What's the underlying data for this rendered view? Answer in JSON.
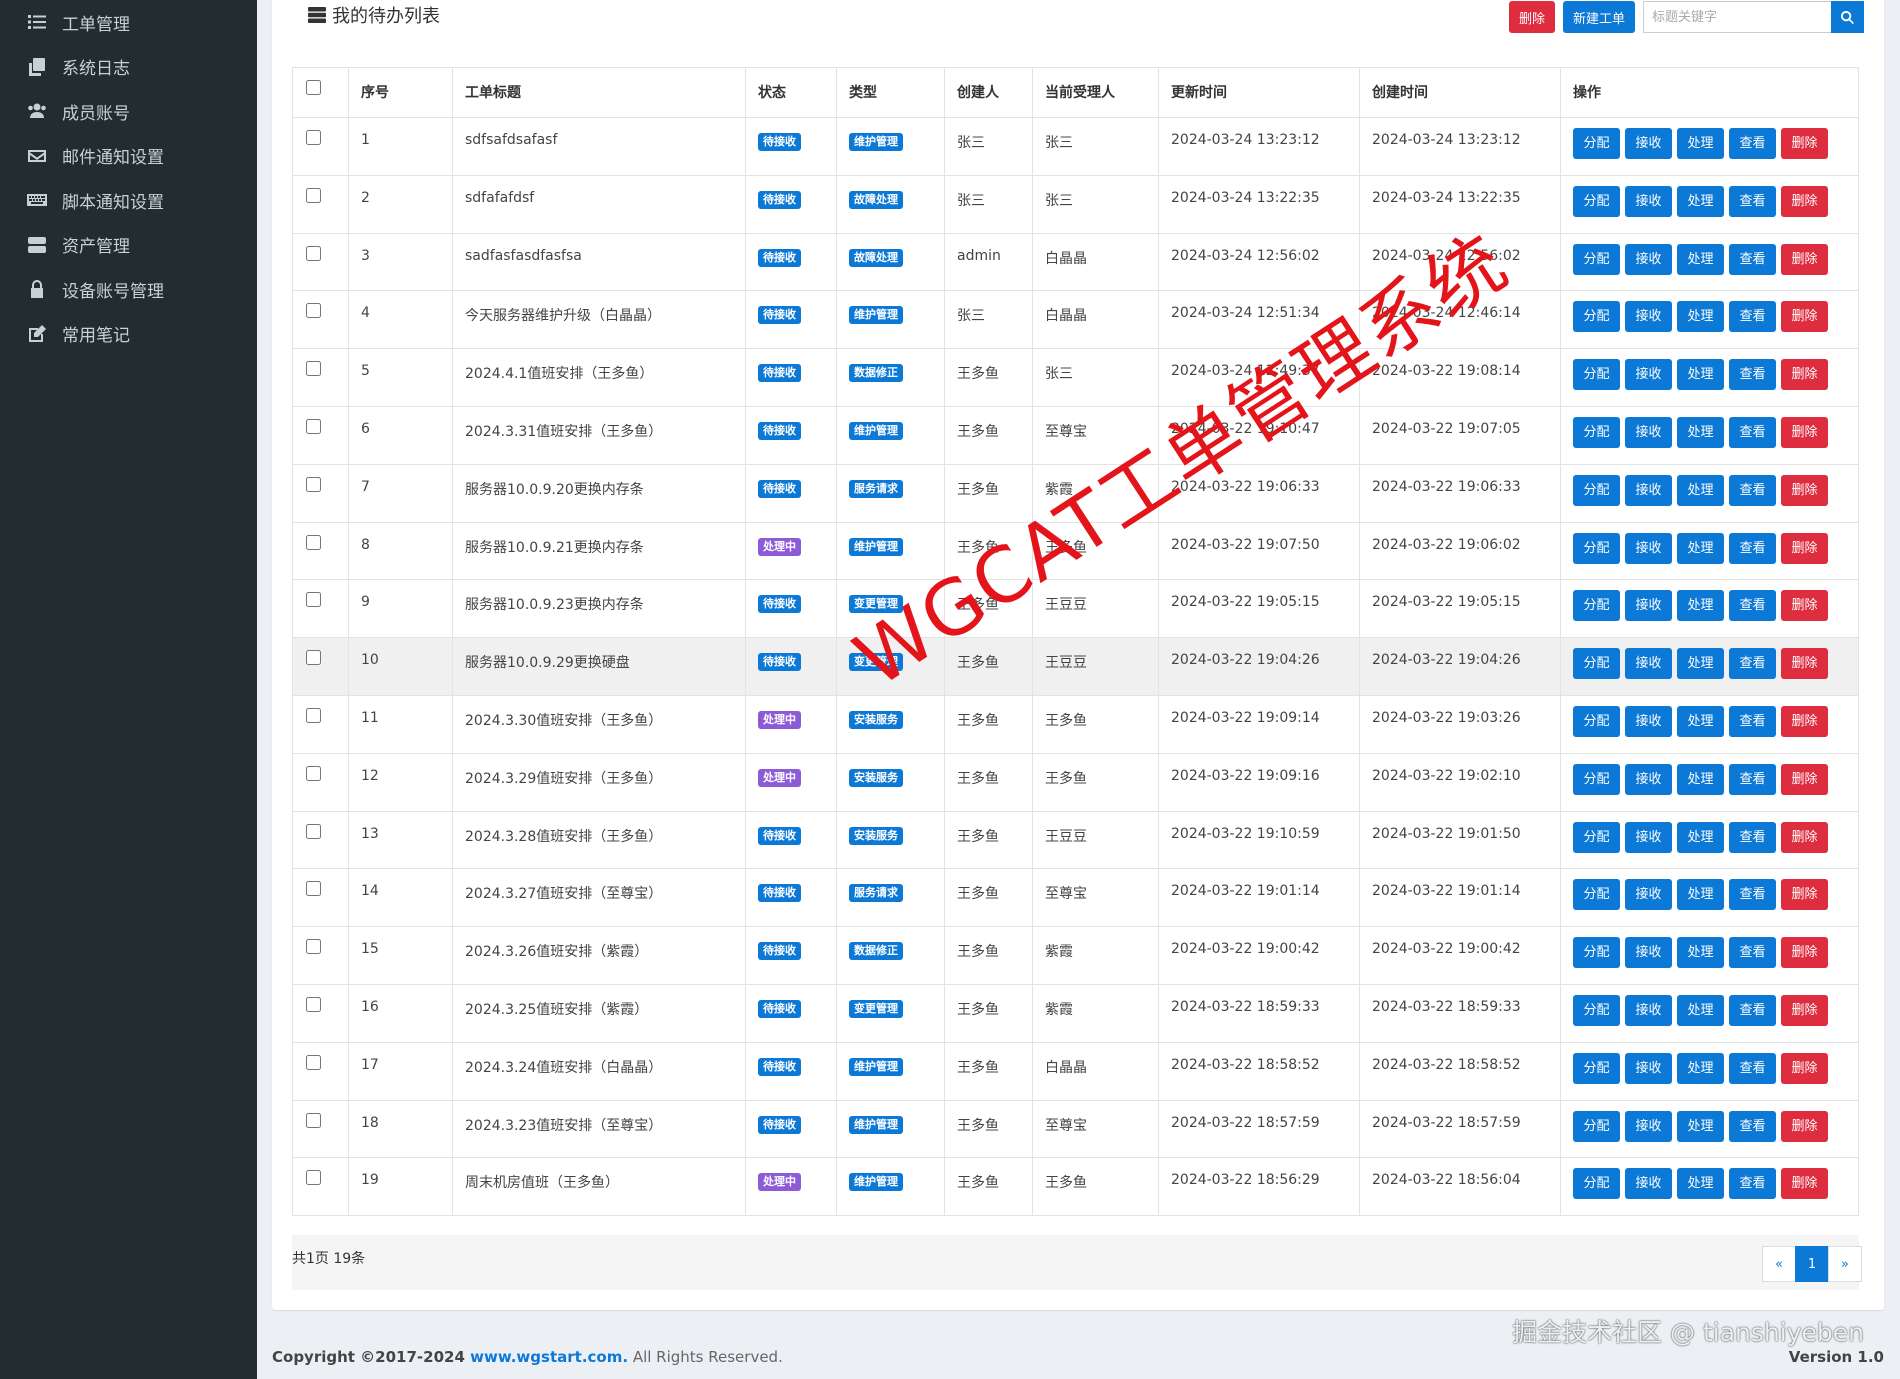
{
  "sidebar": {
    "items": [
      {
        "label": "工单管理",
        "icon": "list-icon"
      },
      {
        "label": "系统日志",
        "icon": "copy-icon"
      },
      {
        "label": "成员账号",
        "icon": "users-icon"
      },
      {
        "label": "邮件通知设置",
        "icon": "envelope-icon"
      },
      {
        "label": "脚本通知设置",
        "icon": "keyboard-icon"
      },
      {
        "label": "资产管理",
        "icon": "server-icon"
      },
      {
        "label": "设备账号管理",
        "icon": "lock-icon"
      },
      {
        "label": "常用笔记",
        "icon": "edit-icon"
      }
    ]
  },
  "box": {
    "title": "我的待办列表",
    "delete_label": "删除",
    "new_label": "新建工单",
    "search_placeholder": "标题关键字"
  },
  "table": {
    "headers": {
      "index": "序号",
      "title": "工单标题",
      "status": "状态",
      "type": "类型",
      "creator": "创建人",
      "assignee": "当前受理人",
      "updated": "更新时间",
      "created": "创建时间",
      "actions": "操作"
    },
    "action_labels": [
      "分配",
      "接收",
      "处理",
      "查看",
      "删除"
    ],
    "rows": [
      {
        "index": "1",
        "title": "sdfsafdsafasf",
        "status": "待接收",
        "type": "维护管理",
        "creator": "张三",
        "assignee": "张三",
        "updated": "2024-03-24 13:23:12",
        "created": "2024-03-24 13:23:12"
      },
      {
        "index": "2",
        "title": "sdfafafdsf",
        "status": "待接收",
        "type": "故障处理",
        "creator": "张三",
        "assignee": "张三",
        "updated": "2024-03-24 13:22:35",
        "created": "2024-03-24 13:22:35"
      },
      {
        "index": "3",
        "title": "sadfasfasdfasfsa",
        "status": "待接收",
        "type": "故障处理",
        "creator": "admin",
        "assignee": "白晶晶",
        "updated": "2024-03-24 12:56:02",
        "created": "2024-03-24 12:56:02"
      },
      {
        "index": "4",
        "title": "今天服务器维护升级（白晶晶）",
        "status": "待接收",
        "type": "维护管理",
        "creator": "张三",
        "assignee": "白晶晶",
        "updated": "2024-03-24 12:51:34",
        "created": "2024-03-24 12:46:14"
      },
      {
        "index": "5",
        "title": "2024.4.1值班安排（王多鱼）",
        "status": "待接收",
        "type": "数据修正",
        "creator": "王多鱼",
        "assignee": "张三",
        "updated": "2024-03-24 12:49:37",
        "created": "2024-03-22 19:08:14"
      },
      {
        "index": "6",
        "title": "2024.3.31值班安排（王多鱼）",
        "status": "待接收",
        "type": "维护管理",
        "creator": "王多鱼",
        "assignee": "至尊宝",
        "updated": "2024-03-22 19:10:47",
        "created": "2024-03-22 19:07:05"
      },
      {
        "index": "7",
        "title": "服务器10.0.9.20更换内存条",
        "status": "待接收",
        "type": "服务请求",
        "creator": "王多鱼",
        "assignee": "紫霞",
        "updated": "2024-03-22 19:06:33",
        "created": "2024-03-22 19:06:33"
      },
      {
        "index": "8",
        "title": "服务器10.0.9.21更换内存条",
        "status": "处理中",
        "type": "维护管理",
        "creator": "王多鱼",
        "assignee": "王多鱼",
        "updated": "2024-03-22 19:07:50",
        "created": "2024-03-22 19:06:02"
      },
      {
        "index": "9",
        "title": "服务器10.0.9.23更换内存条",
        "status": "待接收",
        "type": "变更管理",
        "creator": "王多鱼",
        "assignee": "王豆豆",
        "updated": "2024-03-22 19:05:15",
        "created": "2024-03-22 19:05:15"
      },
      {
        "index": "10",
        "title": "服务器10.0.9.29更换硬盘",
        "status": "待接收",
        "type": "变更管理",
        "creator": "王多鱼",
        "assignee": "王豆豆",
        "updated": "2024-03-22 19:04:26",
        "created": "2024-03-22 19:04:26"
      },
      {
        "index": "11",
        "title": "2024.3.30值班安排（王多鱼）",
        "status": "处理中",
        "type": "安装服务",
        "creator": "王多鱼",
        "assignee": "王多鱼",
        "updated": "2024-03-22 19:09:14",
        "created": "2024-03-22 19:03:26"
      },
      {
        "index": "12",
        "title": "2024.3.29值班安排（王多鱼）",
        "status": "处理中",
        "type": "安装服务",
        "creator": "王多鱼",
        "assignee": "王多鱼",
        "updated": "2024-03-22 19:09:16",
        "created": "2024-03-22 19:02:10"
      },
      {
        "index": "13",
        "title": "2024.3.28值班安排（王多鱼）",
        "status": "待接收",
        "type": "安装服务",
        "creator": "王多鱼",
        "assignee": "王豆豆",
        "updated": "2024-03-22 19:10:59",
        "created": "2024-03-22 19:01:50"
      },
      {
        "index": "14",
        "title": "2024.3.27值班安排（至尊宝）",
        "status": "待接收",
        "type": "服务请求",
        "creator": "王多鱼",
        "assignee": "至尊宝",
        "updated": "2024-03-22 19:01:14",
        "created": "2024-03-22 19:01:14"
      },
      {
        "index": "15",
        "title": "2024.3.26值班安排（紫霞）",
        "status": "待接收",
        "type": "数据修正",
        "creator": "王多鱼",
        "assignee": "紫霞",
        "updated": "2024-03-22 19:00:42",
        "created": "2024-03-22 19:00:42"
      },
      {
        "index": "16",
        "title": "2024.3.25值班安排（紫霞）",
        "status": "待接收",
        "type": "变更管理",
        "creator": "王多鱼",
        "assignee": "紫霞",
        "updated": "2024-03-22 18:59:33",
        "created": "2024-03-22 18:59:33"
      },
      {
        "index": "17",
        "title": "2024.3.24值班安排（白晶晶）",
        "status": "待接收",
        "type": "维护管理",
        "creator": "王多鱼",
        "assignee": "白晶晶",
        "updated": "2024-03-22 18:58:52",
        "created": "2024-03-22 18:58:52"
      },
      {
        "index": "18",
        "title": "2024.3.23值班安排（至尊宝）",
        "status": "待接收",
        "type": "维护管理",
        "creator": "王多鱼",
        "assignee": "至尊宝",
        "updated": "2024-03-22 18:57:59",
        "created": "2024-03-22 18:57:59"
      },
      {
        "index": "19",
        "title": "周末机房值班（王多鱼）",
        "status": "处理中",
        "type": "维护管理",
        "creator": "王多鱼",
        "assignee": "王多鱼",
        "updated": "2024-03-22 18:56:29",
        "created": "2024-03-22 18:56:04"
      }
    ]
  },
  "colors": {
    "status_waiting": "#0d79d6",
    "status_processing": "#8e5bd6",
    "type_badge": "#0d79d6",
    "danger": "#dd2d3f",
    "primary": "#0d79d6"
  },
  "pagination": {
    "summary": "共1页 19条",
    "prev": "«",
    "current": "1",
    "next": "»"
  },
  "footer": {
    "copyright_prefix": "Copyright ©2017-2024 ",
    "site": "www.wgstart.com.",
    "rights": " All Rights Reserved.",
    "version": "Version 1.0"
  },
  "watermarks": {
    "main": "WGCAT工单管理系统",
    "corner": "掘金技术社区 @ tianshiyeben"
  }
}
